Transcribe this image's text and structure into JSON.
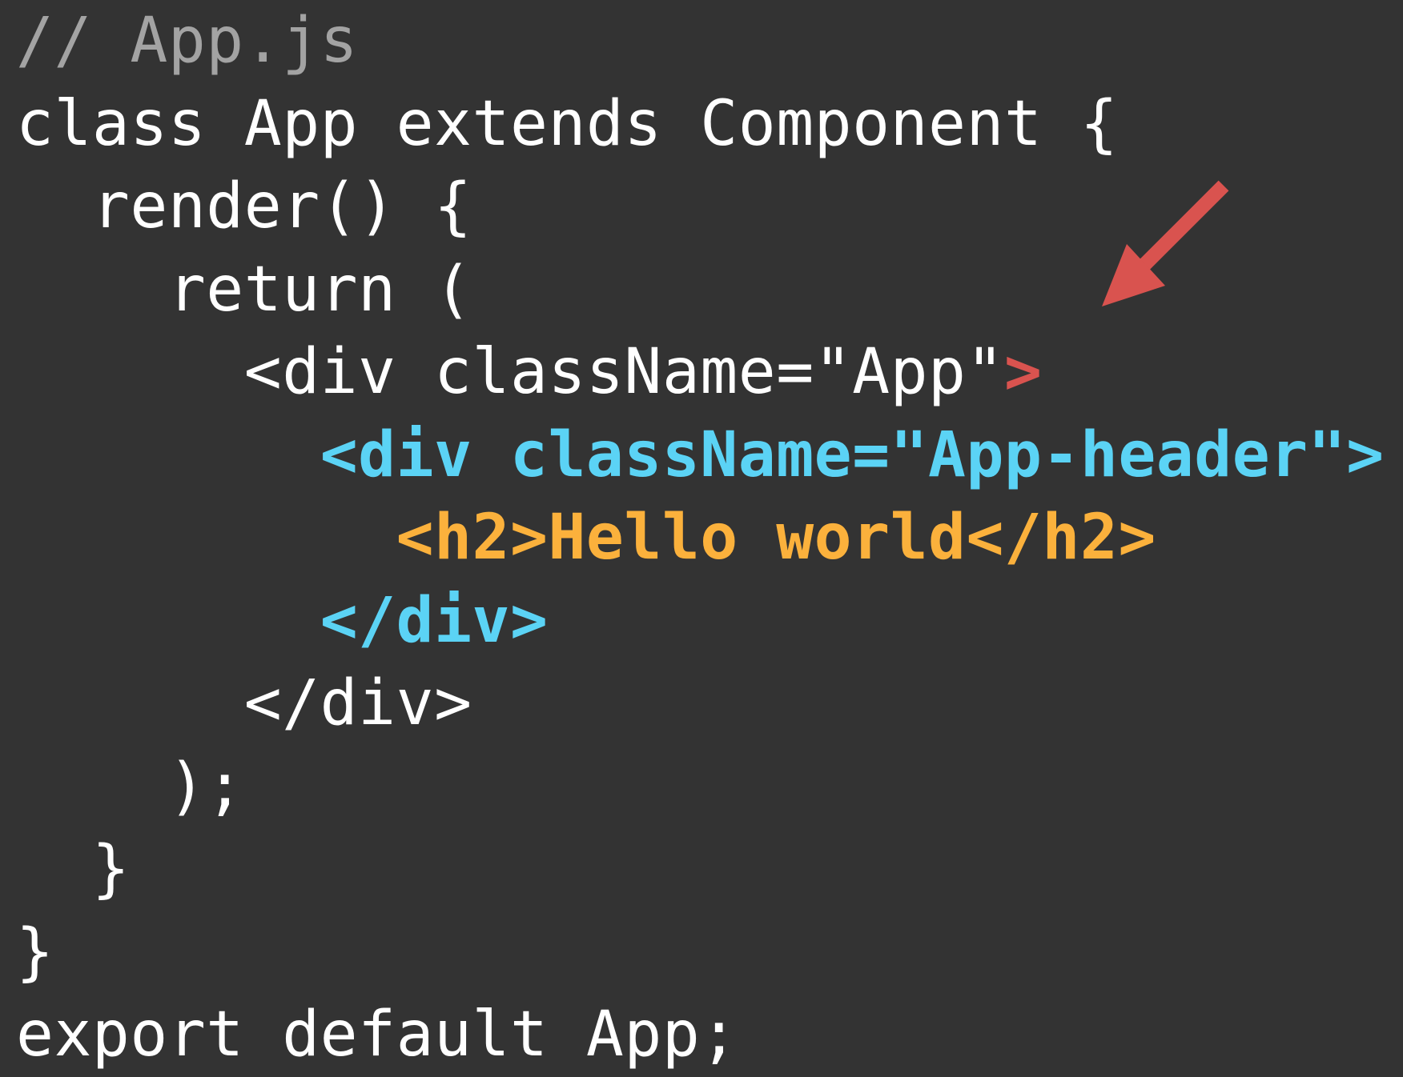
{
  "colors": {
    "background": "#333333",
    "comment": "#a3a3a3",
    "default_text": "#ffffff",
    "highlight_red": "#d9534f",
    "highlight_cyan": "#5bd3f5",
    "highlight_orange": "#fbb13c",
    "arrow": "#d9534f"
  },
  "annotation": {
    "icon": "arrow-down-left-icon"
  },
  "code": {
    "lines": [
      {
        "indent": 0,
        "tokens": [
          {
            "text": "// App.js",
            "style": "comment"
          }
        ]
      },
      {
        "indent": 0,
        "tokens": [
          {
            "text": "class App extends Component {",
            "style": "white"
          }
        ]
      },
      {
        "indent": 2,
        "tokens": [
          {
            "text": "render() {",
            "style": "white"
          }
        ]
      },
      {
        "indent": 4,
        "tokens": [
          {
            "text": "return (",
            "style": "white"
          }
        ]
      },
      {
        "indent": 6,
        "tokens": [
          {
            "text": "<div className=\"App\"",
            "style": "white"
          },
          {
            "text": ">",
            "style": "red"
          }
        ]
      },
      {
        "indent": 8,
        "tokens": [
          {
            "text": "<div className=\"App-header\">",
            "style": "cyan"
          }
        ]
      },
      {
        "indent": 10,
        "tokens": [
          {
            "text": "<h2>Hello world</h2>",
            "style": "orange"
          }
        ]
      },
      {
        "indent": 8,
        "tokens": [
          {
            "text": "</div>",
            "style": "cyan"
          }
        ]
      },
      {
        "indent": 6,
        "tokens": [
          {
            "text": "</div>",
            "style": "white"
          }
        ]
      },
      {
        "indent": 4,
        "tokens": [
          {
            "text": ");",
            "style": "white"
          }
        ]
      },
      {
        "indent": 2,
        "tokens": [
          {
            "text": "}",
            "style": "white"
          }
        ]
      },
      {
        "indent": 0,
        "tokens": [
          {
            "text": "}",
            "style": "white"
          }
        ]
      },
      {
        "indent": 0,
        "tokens": [
          {
            "text": "export default App;",
            "style": "white"
          }
        ]
      }
    ]
  }
}
